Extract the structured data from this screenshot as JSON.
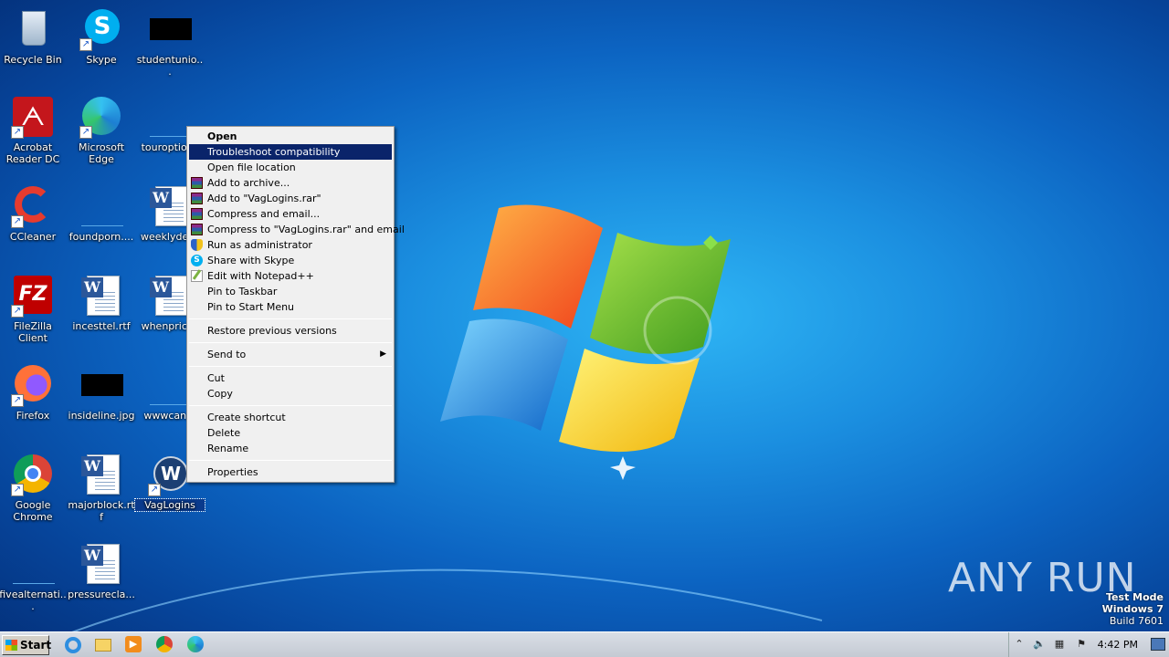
{
  "desktop": {
    "icons": [
      {
        "label": "Recycle Bin",
        "icon": "recycle-bin-icon"
      },
      {
        "label": "Skype",
        "icon": "skype-icon"
      },
      {
        "label": "studentunio...",
        "icon": "image-file-icon"
      },
      {
        "label": "Acrobat Reader DC",
        "icon": "acrobat-icon"
      },
      {
        "label": "Microsoft Edge",
        "icon": "edge-icon"
      },
      {
        "label": "touroptions",
        "icon": "file-icon"
      },
      {
        "label": "CCleaner",
        "icon": "ccleaner-icon"
      },
      {
        "label": "foundporn....",
        "icon": "file-icon"
      },
      {
        "label": "weeklydesc",
        "icon": "word-doc-icon"
      },
      {
        "label": "FileZilla Client",
        "icon": "filezilla-icon"
      },
      {
        "label": "incesttel.rtf",
        "icon": "word-doc-icon"
      },
      {
        "label": "whenprices",
        "icon": "word-doc-icon"
      },
      {
        "label": "Firefox",
        "icon": "firefox-icon"
      },
      {
        "label": "insideline.jpg",
        "icon": "image-file-icon"
      },
      {
        "label": "wwwcan.p",
        "icon": "file-icon"
      },
      {
        "label": "Google Chrome",
        "icon": "chrome-icon"
      },
      {
        "label": "majorblock.rtf",
        "icon": "word-doc-icon"
      },
      {
        "label": "VagLogins",
        "icon": "volkswagen-icon"
      },
      {
        "label": "fivealternati...",
        "icon": "file-icon"
      },
      {
        "label": "pressurecla...",
        "icon": "word-doc-icon"
      }
    ],
    "selected": "VagLogins"
  },
  "context_menu": {
    "items": [
      {
        "label": "Open",
        "bold": true
      },
      {
        "label": "Troubleshoot compatibility",
        "highlighted": true
      },
      {
        "label": "Open file location"
      },
      {
        "label": "Add to archive...",
        "icon": "winrar-icon"
      },
      {
        "label": "Add to \"VagLogins.rar\"",
        "icon": "winrar-icon"
      },
      {
        "label": "Compress and email...",
        "icon": "winrar-icon"
      },
      {
        "label": "Compress to \"VagLogins.rar\" and email",
        "icon": "winrar-icon"
      },
      {
        "label": "Run as administrator",
        "icon": "uac-shield-icon"
      },
      {
        "label": "Share with Skype",
        "icon": "skype-icon"
      },
      {
        "label": "Edit with Notepad++",
        "icon": "notepadpp-icon"
      },
      {
        "label": "Pin to Taskbar"
      },
      {
        "label": "Pin to Start Menu"
      },
      {
        "label": "Restore previous versions"
      },
      {
        "label": "Send to",
        "submenu": true
      },
      {
        "label": "Cut"
      },
      {
        "label": "Copy"
      },
      {
        "label": "Create shortcut"
      },
      {
        "label": "Delete"
      },
      {
        "label": "Rename"
      },
      {
        "label": "Properties"
      }
    ]
  },
  "watermark": {
    "brand": "ANY RUN"
  },
  "test_mode": {
    "line1": "Test Mode",
    "line2": "Windows 7",
    "line3": "Build 7601"
  },
  "taskbar": {
    "start_label": "Start",
    "apps": [
      "internet-explorer-icon",
      "file-explorer-icon",
      "media-player-icon",
      "chrome-icon",
      "edge-icon"
    ],
    "clock": "4:42 PM"
  },
  "colors": {
    "menu_highlight": "#0a246a",
    "desktop_blue": "#1b8fe0"
  }
}
